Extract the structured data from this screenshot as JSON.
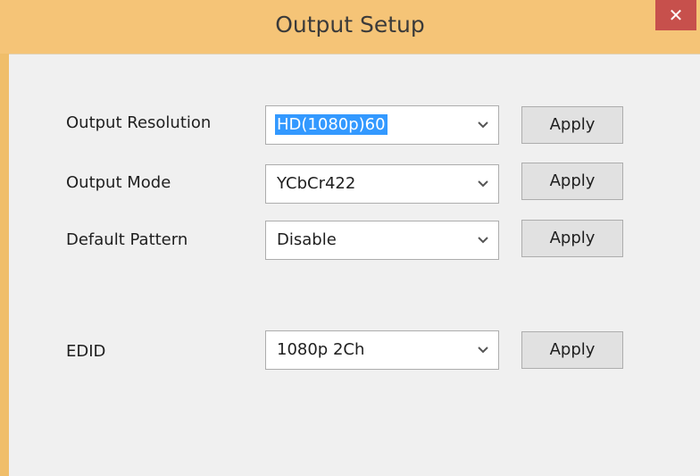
{
  "window": {
    "title": "Output Setup",
    "close_glyph": "✕"
  },
  "rows": [
    {
      "label": "Output Resolution",
      "value": "HD(1080p)60",
      "selected": true,
      "apply_label": "Apply"
    },
    {
      "label": "Output Mode",
      "value": "YCbCr422",
      "selected": false,
      "apply_label": "Apply"
    },
    {
      "label": "Default Pattern",
      "value": "Disable",
      "selected": false,
      "apply_label": "Apply"
    },
    {
      "label": "EDID",
      "value": "1080p 2Ch",
      "selected": false,
      "apply_label": "Apply"
    }
  ],
  "colors": {
    "titlebar": "#f5c477",
    "close_button": "#c7504c",
    "client_background": "#f0f0f0",
    "selection_highlight": "#3399ff"
  },
  "icons": {
    "dropdown": "chevron-down-icon",
    "close": "close-icon"
  }
}
